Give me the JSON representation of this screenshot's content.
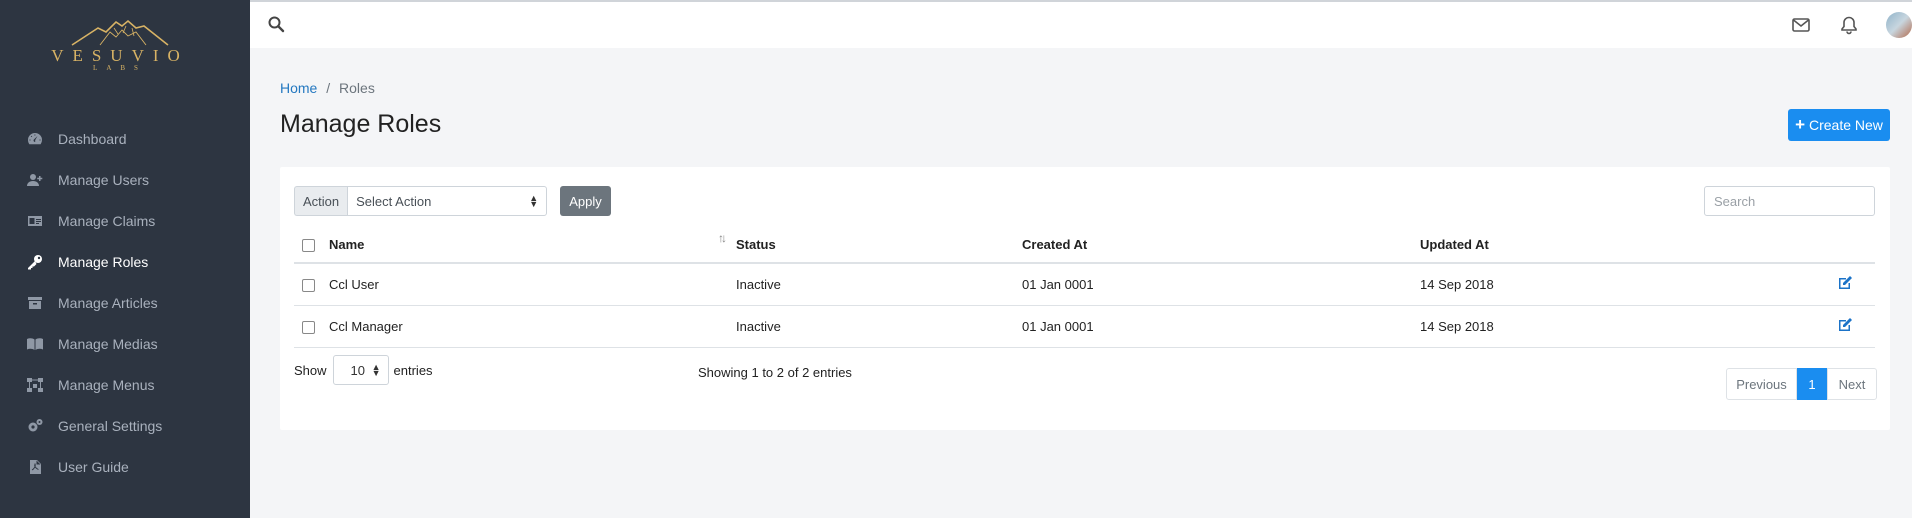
{
  "brand": {
    "name": "VESUVIO",
    "sub": "LABS"
  },
  "sidebar": {
    "items": [
      {
        "label": "Dashboard",
        "icon": "dashboard-gauge-icon",
        "active": false
      },
      {
        "label": "Manage Users",
        "icon": "user-plus-icon",
        "active": false
      },
      {
        "label": "Manage Claims",
        "icon": "id-card-icon",
        "active": false
      },
      {
        "label": "Manage Roles",
        "icon": "key-icon",
        "active": true
      },
      {
        "label": "Manage Articles",
        "icon": "archive-icon",
        "active": false
      },
      {
        "label": "Manage Medias",
        "icon": "book-open-icon",
        "active": false
      },
      {
        "label": "Manage Menus",
        "icon": "sitemap-icon",
        "active": false
      },
      {
        "label": "General Settings",
        "icon": "gears-icon",
        "active": false
      },
      {
        "label": "User Guide",
        "icon": "file-pdf-icon",
        "active": false
      }
    ]
  },
  "topbar": {
    "icons": [
      "search-icon",
      "envelope-icon",
      "bell-icon",
      "avatar"
    ]
  },
  "breadcrumb": {
    "home": "Home",
    "separator": "/",
    "current": "Roles"
  },
  "page": {
    "title": "Manage Roles",
    "create_label": "Create New"
  },
  "toolbar": {
    "action_label": "Action",
    "action_select": "Select Action",
    "apply_label": "Apply",
    "search_placeholder": "Search"
  },
  "table": {
    "headers": {
      "name": "Name",
      "status": "Status",
      "created": "Created At",
      "updated": "Updated At"
    },
    "rows": [
      {
        "name": "Ccl User",
        "status": "Inactive",
        "created": "01 Jan 0001",
        "updated": "14 Sep 2018"
      },
      {
        "name": "Ccl Manager",
        "status": "Inactive",
        "created": "01 Jan 0001",
        "updated": "14 Sep 2018"
      }
    ]
  },
  "footer": {
    "show_label": "Show",
    "page_size": "10",
    "entries_label": "entries",
    "info": "Showing 1 to 2 of 2 entries",
    "prev_label": "Previous",
    "current_page": "1",
    "next_label": "Next"
  },
  "colors": {
    "sidebar_bg": "#2d3541",
    "accent": "#1a8df0",
    "apply_bg": "#6c757d",
    "brand_gold": "#d8b365"
  }
}
